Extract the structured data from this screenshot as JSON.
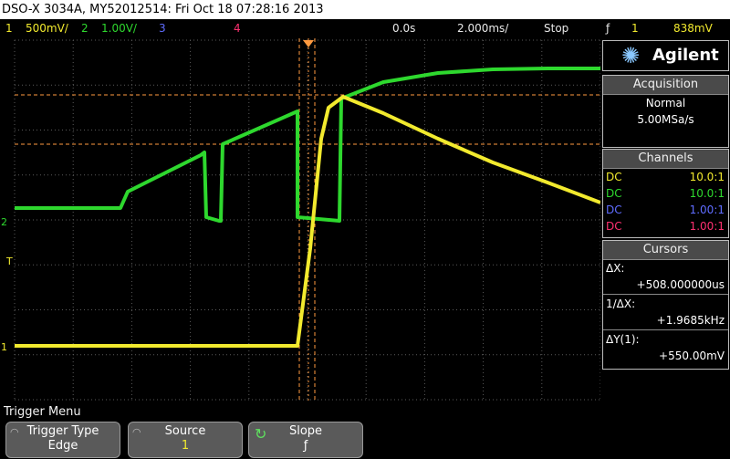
{
  "title": "DSO-X 3034A, MY52012514: Fri Oct 18 07:28:16 2013",
  "status": {
    "ch1_num": "1",
    "ch1_scale": "500mV/",
    "ch2_num": "2",
    "ch2_scale": "1.00V/",
    "ch3_num": "3",
    "ch4_num": "4",
    "time_delay": "0.0s",
    "time_scale": "2.000ms/",
    "run_state": "Stop",
    "trigger_symbol": "ƒ",
    "trigger_source": "1",
    "trigger_level": "838mV"
  },
  "brand": {
    "name": "Agilent",
    "icon": "agilent-spark-icon"
  },
  "acquisition": {
    "header": "Acquisition",
    "mode": "Normal",
    "rate": "5.00MSa/s"
  },
  "channels": {
    "header": "Channels",
    "rows": [
      {
        "coupling": "DC",
        "probe": "10.0:1",
        "color": "#f2ea2e"
      },
      {
        "coupling": "DC",
        "probe": "10.0:1",
        "color": "#2ed82e"
      },
      {
        "coupling": "DC",
        "probe": "1.00:1",
        "color": "#5f6cff"
      },
      {
        "coupling": "DC",
        "probe": "1.00:1",
        "color": "#ff3070"
      }
    ]
  },
  "cursors": {
    "header": "Cursors",
    "dx_label": "ΔX:",
    "dx_value": "+508.000000us",
    "inv_label": "1/ΔX:",
    "inv_value": "+1.9685kHz",
    "dy_label": "ΔY(1):",
    "dy_value": "+550.00mV"
  },
  "markers": {
    "ch2": "2",
    "trig": "T",
    "ch1": "1"
  },
  "menu": {
    "title": "Trigger Menu",
    "softkeys": [
      {
        "title": "Trigger Type",
        "value": "Edge"
      },
      {
        "title": "Source",
        "value": "1"
      },
      {
        "title": "Slope",
        "value": "ƒ"
      }
    ]
  },
  "colors": {
    "ch1": "#f2ea2e",
    "ch2": "#2ed82e",
    "ch3": "#5f6cff",
    "ch4": "#ff3070",
    "cursor": "#ff9a40",
    "grid": "#5a5a5a"
  }
}
